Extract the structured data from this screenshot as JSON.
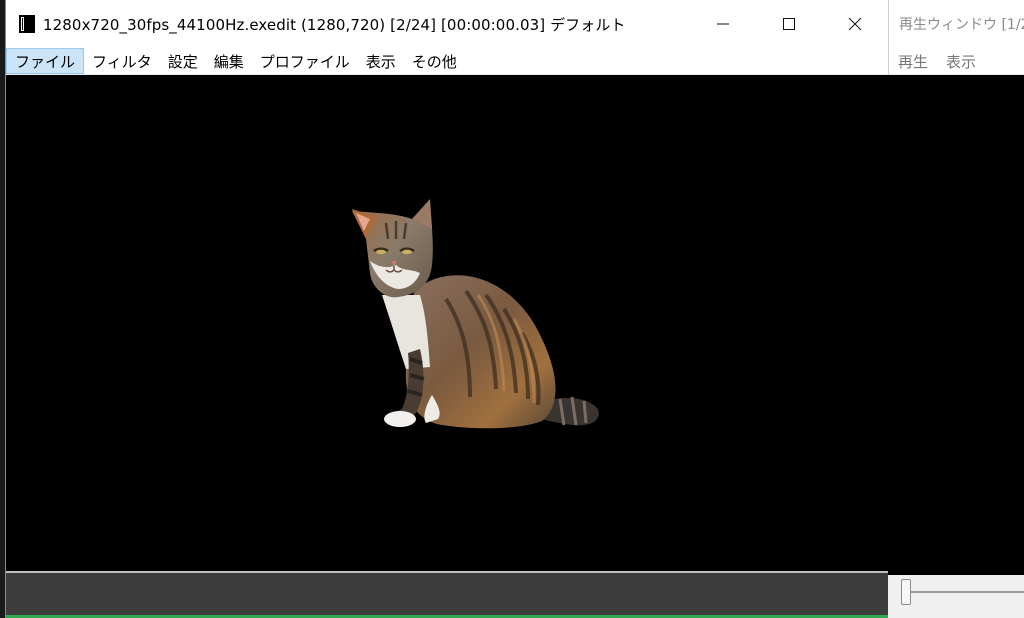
{
  "main_window": {
    "title": "1280x720_30fps_44100Hz.exedit (1280,720)  [2/24] [00:00:00.03]  デフォルト",
    "icon": "film-icon",
    "controls": {
      "minimize": "—",
      "maximize": "☐",
      "close": "✕"
    },
    "menu": [
      {
        "label": "ファイル",
        "active": true
      },
      {
        "label": "フィルタ"
      },
      {
        "label": "設定"
      },
      {
        "label": "編集"
      },
      {
        "label": "プロファイル"
      },
      {
        "label": "表示"
      },
      {
        "label": "その他"
      }
    ],
    "preview_content": "cat-image",
    "colors": {
      "canvas": "#000000",
      "menu_active": "#cce4f7",
      "seek_area": "#3c3c3c",
      "bottom_accent": "#2fa84f"
    }
  },
  "play_window": {
    "title": "再生ウィンドウ [1/2",
    "menu": [
      {
        "label": "再生"
      },
      {
        "label": "表示"
      }
    ],
    "slider_position": 0
  }
}
